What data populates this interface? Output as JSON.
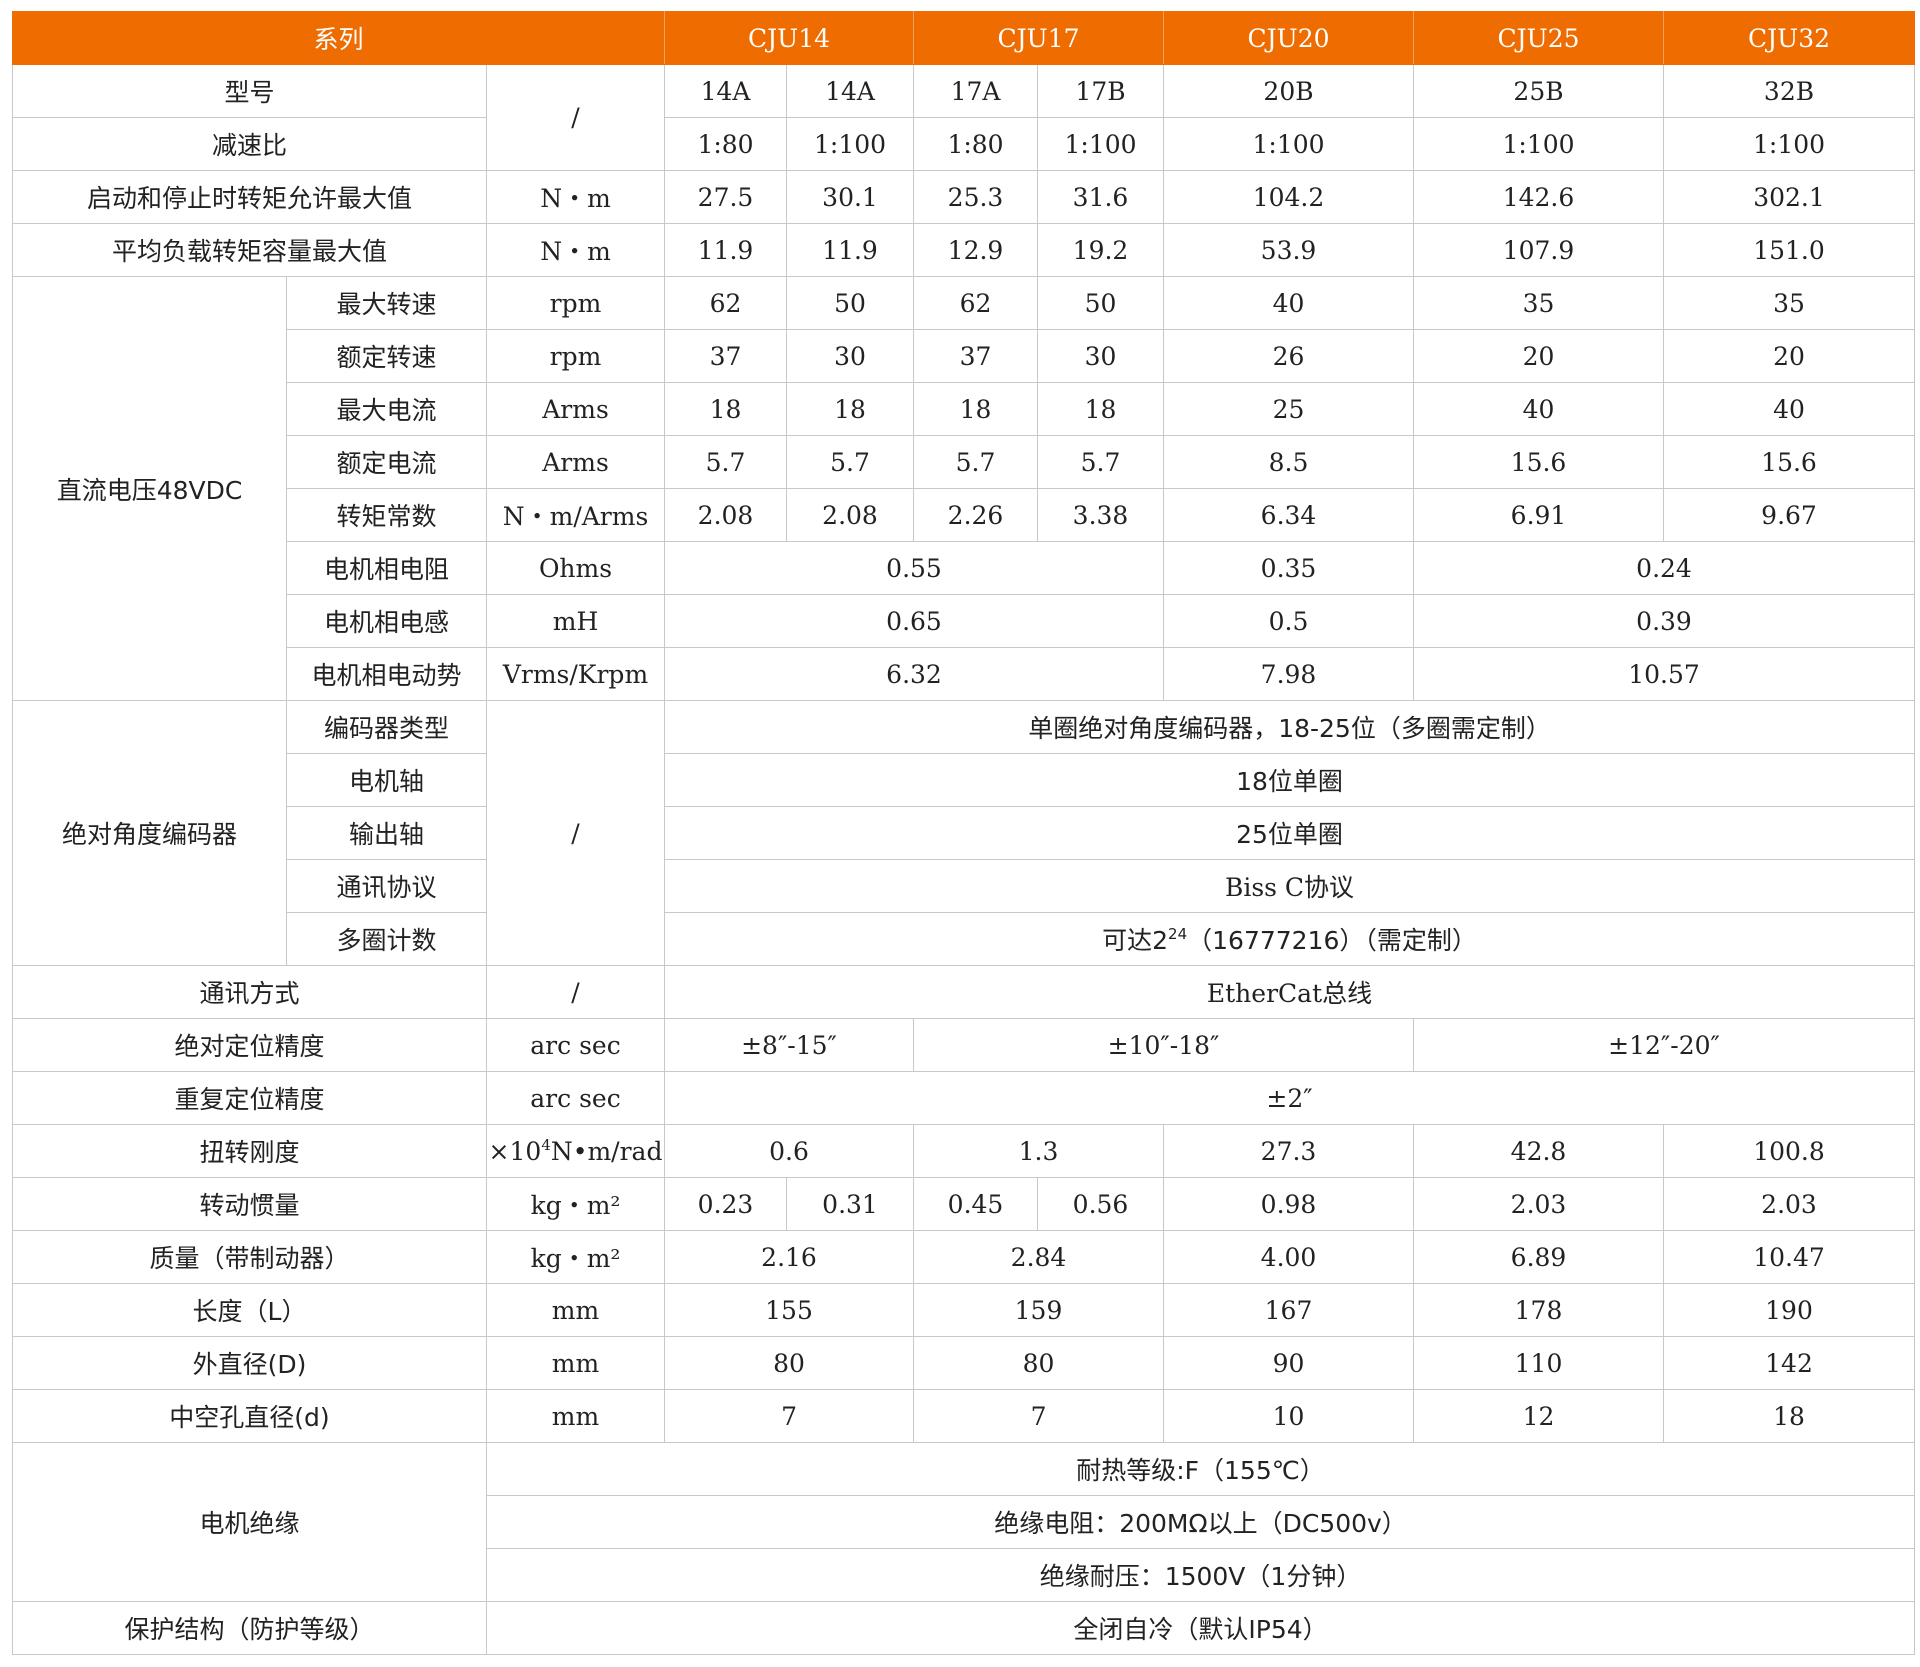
{
  "header": {
    "series_label": "系列",
    "series": [
      "CJU14",
      "CJU17",
      "CJU20",
      "CJU25",
      "CJU32"
    ]
  },
  "model": {
    "label": "型号",
    "unit": "/",
    "values": [
      "14A",
      "14A",
      "17A",
      "17B",
      "20B",
      "25B",
      "32B"
    ]
  },
  "ratio": {
    "label": "减速比",
    "values": [
      "1:80",
      "1:100",
      "1:80",
      "1:100",
      "1:100",
      "1:100",
      "1:100"
    ]
  },
  "start_stop_torque": {
    "label": "启动和停止时转矩允许最大值",
    "unit": "N・m",
    "values": [
      "27.5",
      "30.1",
      "25.3",
      "31.6",
      "104.2",
      "142.6",
      "302.1"
    ]
  },
  "avg_load_torque": {
    "label": "平均负载转矩容量最大值",
    "unit": "N・m",
    "values": [
      "11.9",
      "11.9",
      "12.9",
      "19.2",
      "53.9",
      "107.9",
      "151.0"
    ]
  },
  "dc_voltage": {
    "group_label": "直流电压48VDC",
    "max_speed": {
      "label": "最大转速",
      "unit": "rpm",
      "values": [
        "62",
        "50",
        "62",
        "50",
        "40",
        "35",
        "35"
      ]
    },
    "rated_speed": {
      "label": "额定转速",
      "unit": "rpm",
      "values": [
        "37",
        "30",
        "37",
        "30",
        "26",
        "20",
        "20"
      ]
    },
    "max_current": {
      "label": "最大电流",
      "unit": "Arms",
      "values": [
        "18",
        "18",
        "18",
        "18",
        "25",
        "40",
        "40"
      ]
    },
    "rated_current": {
      "label": "额定电流",
      "unit": "Arms",
      "values": [
        "5.7",
        "5.7",
        "5.7",
        "5.7",
        "8.5",
        "15.6",
        "15.6"
      ]
    },
    "torque_constant": {
      "label": "转矩常数",
      "unit": "N・m/Arms",
      "values": [
        "2.08",
        "2.08",
        "2.26",
        "3.38",
        "6.34",
        "6.91",
        "9.67"
      ]
    },
    "phase_resistance": {
      "label": "电机相电阻",
      "unit": "Ohms",
      "values": [
        "0.55",
        "0.35",
        "0.24"
      ]
    },
    "phase_inductance": {
      "label": "电机相电感",
      "unit": "mH",
      "values": [
        "0.65",
        "0.5",
        "0.39"
      ]
    },
    "phase_emf": {
      "label": "电机相电动势",
      "unit": "Vrms/Krpm",
      "values": [
        "6.32",
        "7.98",
        "10.57"
      ]
    }
  },
  "encoder": {
    "group_label": "绝对角度编码器",
    "unit": "/",
    "type": {
      "label": "编码器类型",
      "value": "单圈绝对角度编码器，18-25位（多圈需定制）"
    },
    "motor_shaft": {
      "label": "电机轴",
      "value": "18位单圈"
    },
    "output_shaft": {
      "label": "输出轴",
      "value": "25位单圈"
    },
    "protocol": {
      "label": "通讯协议",
      "value": "Biss C协议"
    },
    "multiturn": {
      "label": "多圈计数",
      "prefix": "可达2",
      "sup": "24",
      "suffix": "（16777216）（需定制）"
    }
  },
  "comm": {
    "label": "通讯方式",
    "unit": "/",
    "value": "EtherCat总线"
  },
  "abs_accuracy": {
    "label": "绝对定位精度",
    "unit": "arc sec",
    "values": [
      "±8″-15″",
      "±10″-18″",
      "±12″-20″"
    ]
  },
  "repeat_accuracy": {
    "label": "重复定位精度",
    "unit": "arc sec",
    "value": "±2″"
  },
  "torsional_stiffness": {
    "label": "扭转刚度",
    "unit_prefix": "×10",
    "unit_sup": "4",
    "unit_suffix": "N•m/rad",
    "values": [
      "0.6",
      "1.3",
      "27.3",
      "42.8",
      "100.8"
    ]
  },
  "inertia": {
    "label": "转动惯量",
    "unit": "kg・m²",
    "values": [
      "0.23",
      "0.31",
      "0.45",
      "0.56",
      "0.98",
      "2.03",
      "2.03"
    ]
  },
  "mass": {
    "label": "质量（带制动器）",
    "unit": "kg・m²",
    "values": [
      "2.16",
      "2.84",
      "4.00",
      "6.89",
      "10.47"
    ]
  },
  "length": {
    "label": "长度（L）",
    "unit": "mm",
    "values": [
      "155",
      "159",
      "167",
      "178",
      "190"
    ]
  },
  "outer_diameter": {
    "label": "外直径(D)",
    "unit": "mm",
    "values": [
      "80",
      "80",
      "90",
      "110",
      "142"
    ]
  },
  "hollow_diameter": {
    "label": "中空孔直径(d)",
    "unit": "mm",
    "values": [
      "7",
      "7",
      "10",
      "12",
      "18"
    ]
  },
  "insulation": {
    "label": "电机绝缘",
    "values": [
      "耐热等级:F（155℃）",
      "绝缘电阻：200MΩ以上（DC500v）",
      "绝缘耐压：1500V（1分钟）"
    ]
  },
  "protection": {
    "label": "保护结构（防护等级）",
    "value": "全闭自冷（默认IP54）"
  }
}
